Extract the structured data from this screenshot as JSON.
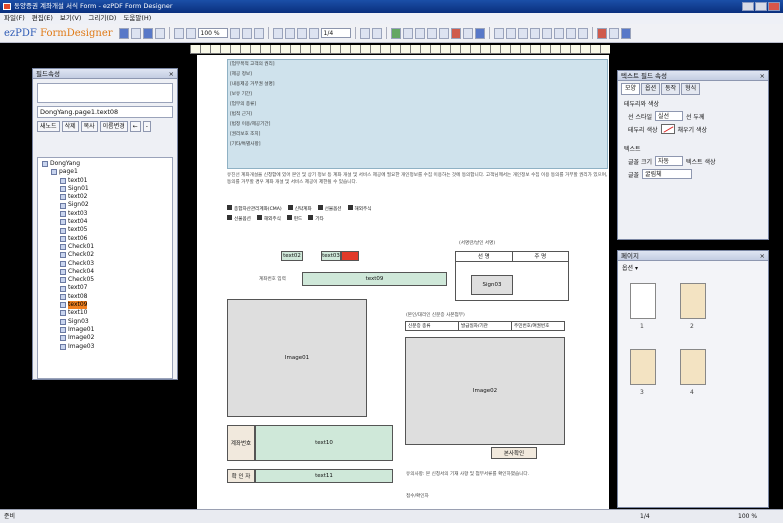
{
  "title": "동양증권 계좌개설 서식 Form - ezPDF Form Designer",
  "menu": [
    "파일(F)",
    "편집(E)",
    "보기(V)",
    "그리기(D)",
    "도움말(H)"
  ],
  "toolbar": {
    "logo_prefix": "ezPDF",
    "logo": "FormDesigner",
    "zoom": "100 %",
    "page": "1/4"
  },
  "field_panel": {
    "title": "필드속성",
    "selected_name": "DongYang.page1.text08",
    "buttons": [
      "새노드",
      "삭제",
      "복사",
      "이름변경"
    ]
  },
  "tree": [
    {
      "label": "DongYang",
      "indent": 0,
      "type": "root"
    },
    {
      "label": "page1",
      "indent": 1,
      "type": "page"
    },
    {
      "label": "text01",
      "indent": 2,
      "type": "text"
    },
    {
      "label": "Sign01",
      "indent": 2,
      "type": "sign"
    },
    {
      "label": "text02",
      "indent": 2,
      "type": "text"
    },
    {
      "label": "Sign02",
      "indent": 2,
      "type": "sign"
    },
    {
      "label": "text03",
      "indent": 2,
      "type": "text"
    },
    {
      "label": "text04",
      "indent": 2,
      "type": "text"
    },
    {
      "label": "text05",
      "indent": 2,
      "type": "text"
    },
    {
      "label": "text06",
      "indent": 2,
      "type": "text"
    },
    {
      "label": "Check01",
      "indent": 2,
      "type": "check"
    },
    {
      "label": "Check02",
      "indent": 2,
      "type": "check"
    },
    {
      "label": "Check03",
      "indent": 2,
      "type": "check"
    },
    {
      "label": "Check04",
      "indent": 2,
      "type": "check"
    },
    {
      "label": "Check05",
      "indent": 2,
      "type": "check"
    },
    {
      "label": "text07",
      "indent": 2,
      "type": "text"
    },
    {
      "label": "text08",
      "indent": 2,
      "type": "text"
    },
    {
      "label": "text09",
      "indent": 2,
      "type": "text",
      "selected": true
    },
    {
      "label": "text10",
      "indent": 2,
      "type": "text"
    },
    {
      "label": "Sign03",
      "indent": 2,
      "type": "sign"
    },
    {
      "label": "Image01",
      "indent": 2,
      "type": "image"
    },
    {
      "label": "Image02",
      "indent": 2,
      "type": "image"
    },
    {
      "label": "Image03",
      "indent": 2,
      "type": "image"
    }
  ],
  "document": {
    "info_labels": [
      "[업무목적 고객의 권리]",
      "[제공 정보]",
      "[내용제공 거부권 설명]",
      "[보유 기간]",
      "[업무의 종류]",
      "[법적 근거]",
      "[법정 이용/제공기간]",
      "[권리보호 조치]",
      "[기타/특별사항]"
    ],
    "intro_para": "유진선 계좌개설을 신청함에 있어 본인 및 상기 정보 등 계좌 개설 및 서비스 제공에 필요한 개인정보를 수집 이용하는 것에 동의합니다. 고객님께서는 개인정보 수집 이용 동의를 거부할 권리가 있으며, 동의를 거부할 경우 계좌 개설 및 서비스 제공이 제한될 수 있습니다.",
    "checks1": [
      "종합자산관리계좌(CMA)",
      "신탁계좌",
      "선물옵션",
      "해외주식"
    ],
    "checks2": [
      "선물옵션",
      "해외주식",
      "펀드",
      "기타"
    ],
    "field_labels": [
      "text02",
      "text03",
      "text09",
      "Sign03",
      "Image01",
      "Image02",
      "text10",
      "text11"
    ],
    "labels": {
      "account_title": "계좌번호 입력",
      "sign_label": "(서명란/날인 서명)",
      "inner_col1": "선 명",
      "inner_col2": "주 명",
      "sub_title": "(본인/대리인 신분증 사본첨부)",
      "sub1": "신분증 종류",
      "sub2": "발급일자/기관",
      "sub3": "주민번호/여권번호",
      "bank_label": "계좌번호",
      "approve_label": "확 인 자",
      "review_label": "본사확인",
      "notice": "유의사항: 본 신청서의 기재 사항 및 첨부서류를 확인하였습니다.",
      "bottom": "접수/확인자"
    }
  },
  "props": {
    "title": "텍스트 필드 속성",
    "tabs": [
      "모양",
      "옵션",
      "동작",
      "형식"
    ],
    "group1": "테두리와 색상",
    "border_style_label": "선 스타일",
    "border_style_value": "실선",
    "border_width_label": "선 두께",
    "border_color_label": "테두리 색상",
    "fill_label": "채우기 색상",
    "group2": "텍스트",
    "font_size_label": "글꼴 크기",
    "font_size_value": "자동",
    "text_color_label": "텍스트 색상",
    "font_label": "글꼴",
    "font_value": "굴림체"
  },
  "thumbs": {
    "title": "페이지",
    "option": "옵션",
    "pages": [
      "1",
      "2",
      "3",
      "4"
    ]
  },
  "status": {
    "left": "준비",
    "page": "1/4",
    "zoom": "100 %"
  }
}
